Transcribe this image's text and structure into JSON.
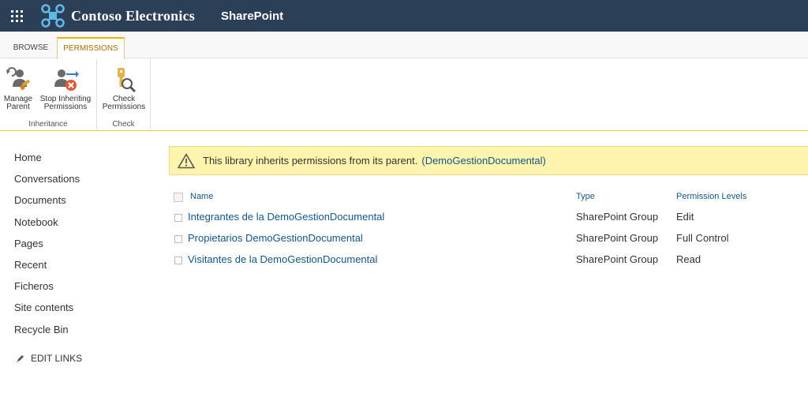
{
  "suite_bar": {
    "brand_name": "Contoso Electronics",
    "app_name": "SharePoint",
    "background_color": "#2b3f57",
    "waffle_icon": "app-launcher-icon",
    "logo_icon": "contoso-logo-icon"
  },
  "ribbon": {
    "tabs": [
      {
        "label": "BROWSE",
        "active": false
      },
      {
        "label": "PERMISSIONS",
        "active": true
      }
    ],
    "groups": {
      "inheritance": {
        "label": "Inheritance",
        "buttons": [
          {
            "label_line1": "Manage",
            "label_line2": "Parent",
            "icon": "manage-parent-icon"
          },
          {
            "label_line1": "Stop Inheriting",
            "label_line2": "Permissions",
            "icon": "stop-inheriting-icon"
          }
        ]
      },
      "check": {
        "label": "Check",
        "buttons": [
          {
            "label_line1": "Check",
            "label_line2": "Permissions",
            "icon": "check-permissions-icon"
          }
        ]
      }
    },
    "accent_color": "#f0b100"
  },
  "left_nav": {
    "items": [
      "Home",
      "Conversations",
      "Documents",
      "Notebook",
      "Pages",
      "Recent",
      "Ficheros",
      "Site contents",
      "Recycle Bin"
    ],
    "edit_links": "EDIT LINKS"
  },
  "notice": {
    "text": "This library inherits permissions from its parent.",
    "link": "(DemoGestionDocumental)",
    "background_color": "#fff4ad",
    "icon": "warning-icon"
  },
  "permissions_table": {
    "columns": [
      "Name",
      "Type",
      "Permission Levels"
    ],
    "rows": [
      {
        "name": "Integrantes de la DemoGestionDocumental",
        "type": "SharePoint Group",
        "level": "Edit"
      },
      {
        "name": "Propietarios DemoGestionDocumental",
        "type": "SharePoint Group",
        "level": "Full Control"
      },
      {
        "name": "Visitantes de la DemoGestionDocumental",
        "type": "SharePoint Group",
        "level": "Read"
      }
    ],
    "link_color": "#14568a"
  }
}
